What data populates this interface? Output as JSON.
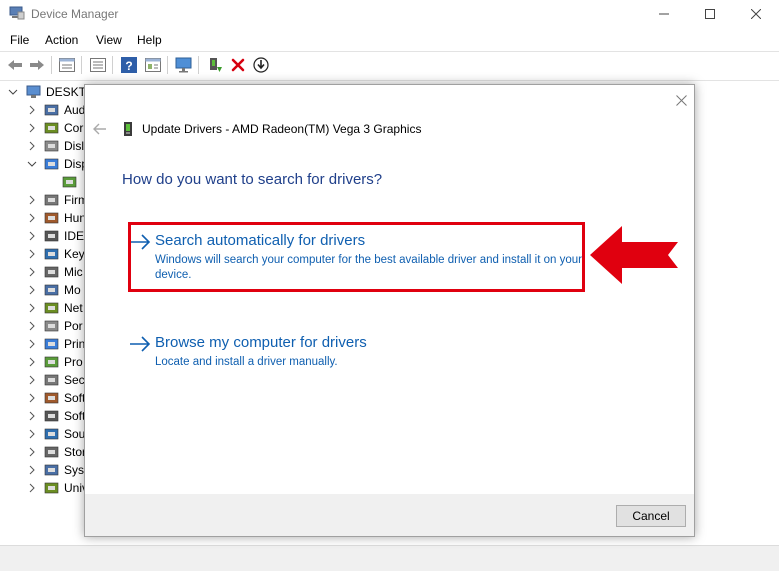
{
  "window": {
    "title": "Device Manager"
  },
  "menu": [
    "File",
    "Action",
    "View",
    "Help"
  ],
  "toolbar_icons": [
    "back-arrow-icon",
    "forward-arrow-icon",
    "properties-icon",
    "list-icon",
    "help-icon",
    "details-icon",
    "monitor-icon",
    "add-driver-icon",
    "uninstall-icon",
    "download-icon"
  ],
  "tree": {
    "root": "DESKTO",
    "items": [
      {
        "label": "Aud",
        "expanded": false
      },
      {
        "label": "Cor",
        "expanded": false
      },
      {
        "label": "Disl",
        "expanded": false
      },
      {
        "label": "Disp",
        "expanded": true
      },
      {
        "label": "",
        "child": true
      },
      {
        "label": "Firm",
        "expanded": false
      },
      {
        "label": "Hun",
        "expanded": false
      },
      {
        "label": "IDE",
        "expanded": false
      },
      {
        "label": "Key",
        "expanded": false
      },
      {
        "label": "Mic",
        "expanded": false
      },
      {
        "label": "Mo",
        "expanded": false
      },
      {
        "label": "Net",
        "expanded": false
      },
      {
        "label": "Por",
        "expanded": false
      },
      {
        "label": "Prin",
        "expanded": false
      },
      {
        "label": "Pro",
        "expanded": false
      },
      {
        "label": "Sec",
        "expanded": false
      },
      {
        "label": "Soft",
        "expanded": false
      },
      {
        "label": "Soft",
        "expanded": false
      },
      {
        "label": "Sou",
        "expanded": false
      },
      {
        "label": "Stor",
        "expanded": false
      },
      {
        "label": "Syst",
        "expanded": false
      },
      {
        "label": "Univ",
        "expanded": false
      }
    ]
  },
  "dialog": {
    "title": "Update Drivers - AMD Radeon(TM) Vega 3 Graphics",
    "heading": "How do you want to search for drivers?",
    "options": [
      {
        "title": "Search automatically for drivers",
        "description": "Windows will search your computer for the best available driver and install it on your device."
      },
      {
        "title": "Browse my computer for drivers",
        "description": "Locate and install a driver manually."
      }
    ],
    "cancel_label": "Cancel"
  },
  "colors": {
    "link_blue": "#0f5fb0",
    "heading_blue": "#1f3f8a",
    "annotation_red": "#e0000f"
  }
}
